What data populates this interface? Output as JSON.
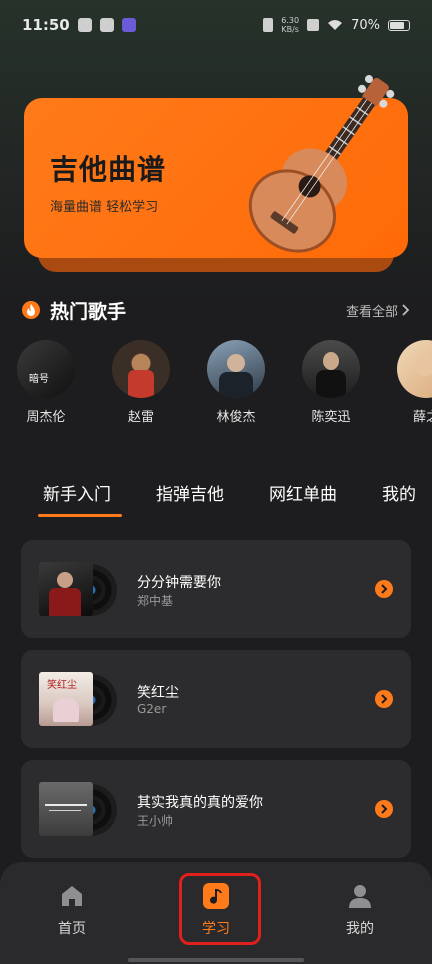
{
  "status_bar": {
    "time": "11:50",
    "speed_top": "6.30",
    "speed_bottom": "KB/s",
    "battery": "70%"
  },
  "banner": {
    "title": "吉他曲谱",
    "subtitle": "海量曲谱 轻松学习"
  },
  "hot_singers": {
    "title": "热门歌手",
    "more_label": "查看全部",
    "singers": [
      {
        "name": "周杰伦"
      },
      {
        "name": "赵雷"
      },
      {
        "name": "林俊杰"
      },
      {
        "name": "陈奕迅"
      },
      {
        "name": "薛之"
      }
    ]
  },
  "tabs": [
    {
      "label": "新手入门",
      "active": true
    },
    {
      "label": "指弹吉他"
    },
    {
      "label": "网红单曲"
    },
    {
      "label": "我的"
    }
  ],
  "songs": [
    {
      "title": "分分钟需要你",
      "artist": "郑中基"
    },
    {
      "title": "笑红尘",
      "artist": "G2er"
    },
    {
      "title": "其实我真的真的爱你",
      "artist": "王小帅"
    }
  ],
  "bottom_nav": [
    {
      "label": "首页",
      "icon": "home-icon"
    },
    {
      "label": "学习",
      "icon": "music-note-icon",
      "active": true
    },
    {
      "label": "我的",
      "icon": "user-icon"
    }
  ],
  "colors": {
    "accent": "#ff7a1a",
    "background": "#1d1d1f",
    "card": "#2c2c2e",
    "highlight": "#e0201d"
  }
}
